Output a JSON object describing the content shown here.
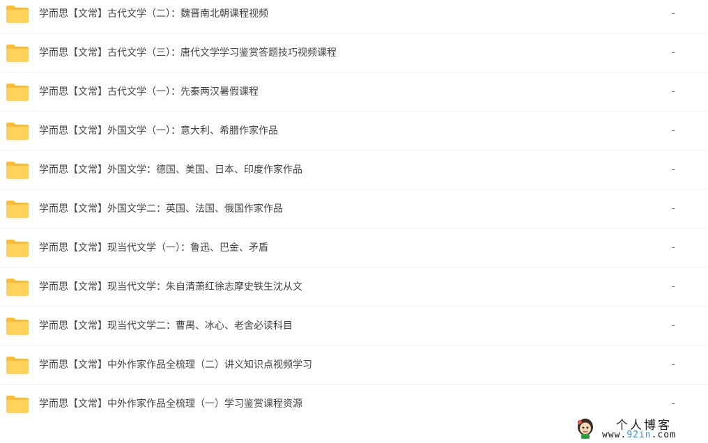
{
  "files": [
    {
      "name": "学而思【文常】古代文学（二）：魏晋南北朝课程视频",
      "size": "-"
    },
    {
      "name": "学而思【文常】古代文学（三）：唐代文学学习鉴赏答题技巧视频课程",
      "size": "-"
    },
    {
      "name": "学而思【文常】古代文学（一）：先秦两汉暑假课程",
      "size": "-"
    },
    {
      "name": "学而思【文常】外国文学（一）：意大利、希腊作家作品",
      "size": "-"
    },
    {
      "name": "学而思【文常】外国文学：德国、美国、日本、印度作家作品",
      "size": "-"
    },
    {
      "name": "学而思【文常】外国文学二：英国、法国、俄国作家作品",
      "size": "-"
    },
    {
      "name": "学而思【文常】现当代文学（一）：鲁迅、巴金、矛盾",
      "size": "-"
    },
    {
      "name": "学而思【文常】现当代文学：朱自清萧红徐志摩史铁生沈从文",
      "size": "-"
    },
    {
      "name": "学而思【文常】现当代文学二：曹禺、冰心、老舍必读科目",
      "size": "-"
    },
    {
      "name": "学而思【文常】中外作家作品全梳理（二）讲义知识点视频学习",
      "size": "-"
    },
    {
      "name": "学而思【文常】中外作家作品全梳理（一）学习鉴赏课程资源",
      "size": "-"
    }
  ],
  "icons": {
    "folder": "folder-icon",
    "folder_color": "#FFD25C",
    "folder_tab_color": "#F5BE3F"
  },
  "watermark": {
    "title": "个人博客",
    "url_prefix": "www.",
    "url_accent": "92in",
    "url_suffix": ".com"
  }
}
